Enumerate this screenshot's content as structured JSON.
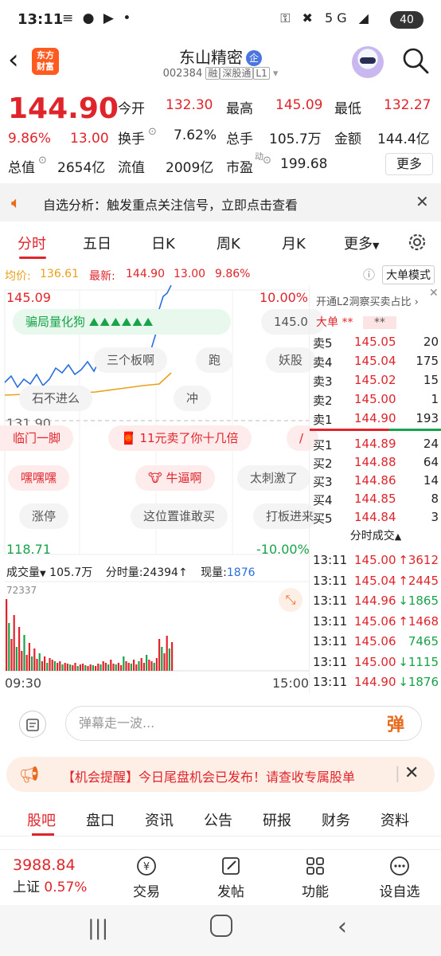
{
  "status": {
    "time": "13:11",
    "left_icons": "≡ ● ▶ •",
    "right_icons": "⚿ ✖ 5G ◢",
    "battery": "40"
  },
  "header": {
    "logo_line1": "东方",
    "logo_line2": "财富",
    "stock_name": "东山精密",
    "badge": "企",
    "code": "002384",
    "tags": [
      "融",
      "深股通",
      "L1"
    ]
  },
  "quote": {
    "price": "144.90",
    "change_pct": "9.86%",
    "change_amt": "13.00",
    "rows": [
      [
        {
          "label": "今开",
          "value": "132.30",
          "color": "red"
        },
        {
          "label": "最高",
          "value": "145.09",
          "color": "red"
        },
        {
          "label": "最低",
          "value": "132.27",
          "color": "red"
        }
      ],
      [
        {
          "label": "换手",
          "value": "7.62%",
          "color": "plain"
        },
        {
          "label": "总手",
          "value": "105.7万",
          "color": "plain"
        },
        {
          "label": "金额",
          "value": "144.4亿",
          "color": "plain"
        }
      ],
      [
        {
          "label": "总值",
          "value": "2654亿",
          "color": "plain"
        },
        {
          "label": "流值",
          "value": "2009亿",
          "color": "plain"
        },
        {
          "label": "市盈",
          "value": "199.68",
          "color": "plain"
        }
      ]
    ],
    "pe_superscript": "动",
    "more_label": "更多"
  },
  "notice": {
    "text": "自选分析：触发重点关注信号，立即点击查看"
  },
  "tabs": [
    "分时",
    "五日",
    "日K",
    "周K",
    "月K",
    "更多"
  ],
  "avg_line": {
    "avg_label": "均价:",
    "avg_value": "136.61",
    "latest_label": "最新:",
    "latest_value": "144.90",
    "latest_amt": "13.00",
    "latest_pct": "9.86%",
    "big_order_mode": "大单模式"
  },
  "chart": {
    "top_price": "145.09",
    "top_pct": "10.00%",
    "mid_price": "131.90",
    "bottom_price": "118.71",
    "bottom_pct": "-10.00%",
    "right_clip_price": "145.0",
    "volume_label": "成交量",
    "volume_value": "105.7万",
    "tick_volume_label": "分时量:",
    "tick_volume_value": "24394",
    "current_volume_label": "现量:",
    "current_volume_value": "1876",
    "volume_max": "72337",
    "start_time": "09:30",
    "end_time": "15:00",
    "danmu": [
      {
        "text": "骗局量化狗"
      },
      {
        "text": "三个板啊"
      },
      {
        "text": "跑"
      },
      {
        "text": "妖股"
      },
      {
        "text": "石不进么"
      },
      {
        "text": "冲"
      },
      {
        "text": "临门一脚"
      },
      {
        "text": "11元卖了你十几倍"
      },
      {
        "text": "嘿嘿嘿"
      },
      {
        "text": "牛逼啊"
      },
      {
        "text": "太刺激了"
      },
      {
        "text": "涨停"
      },
      {
        "text": "这位置谁敢买"
      },
      {
        "text": "打板进来"
      }
    ]
  },
  "orderbook": {
    "header": "开通L2洞察买卖占比",
    "big_order": "大单",
    "stars1": "**",
    "stars2": "**",
    "asks": [
      {
        "label": "卖5",
        "price": "145.05",
        "vol": "20"
      },
      {
        "label": "卖4",
        "price": "145.04",
        "vol": "175"
      },
      {
        "label": "卖3",
        "price": "145.02",
        "vol": "15"
      },
      {
        "label": "卖2",
        "price": "145.00",
        "vol": "1"
      },
      {
        "label": "卖1",
        "price": "144.90",
        "vol": "193"
      }
    ],
    "bids": [
      {
        "label": "买1",
        "price": "144.89",
        "vol": "24"
      },
      {
        "label": "买2",
        "price": "144.88",
        "vol": "64"
      },
      {
        "label": "买3",
        "price": "144.86",
        "vol": "14"
      },
      {
        "label": "买4",
        "price": "144.85",
        "vol": "8"
      },
      {
        "label": "买5",
        "price": "144.84",
        "vol": "3"
      }
    ],
    "trades_header": "分时成交",
    "trades": [
      {
        "time": "13:11",
        "price": "145.00",
        "dir": "up",
        "vol": "3612"
      },
      {
        "time": "13:11",
        "price": "145.04",
        "dir": "up",
        "vol": "2445"
      },
      {
        "time": "13:11",
        "price": "144.96",
        "dir": "down",
        "vol": "1865"
      },
      {
        "time": "13:11",
        "price": "145.06",
        "dir": "up",
        "vol": "1468"
      },
      {
        "time": "13:11",
        "price": "145.06",
        "dir": "none",
        "vol": "7465"
      },
      {
        "time": "13:11",
        "price": "145.00",
        "dir": "down",
        "vol": "1115"
      },
      {
        "time": "13:11",
        "price": "144.90",
        "dir": "down",
        "vol": "1876"
      }
    ]
  },
  "input": {
    "placeholder": "弹幕走一波...",
    "send": "弹"
  },
  "promo": {
    "text": "【机会提醒】今日尾盘机会已发布！请查收专属股单"
  },
  "subtabs": [
    "股吧",
    "盘口",
    "资讯",
    "公告",
    "研报",
    "财务",
    "资料"
  ],
  "bottombar": {
    "index_value": "3988.84",
    "index_name": "上证",
    "index_pct": "0.57%",
    "items": [
      "交易",
      "发帖",
      "功能",
      "设自选"
    ]
  },
  "colors": {
    "up": "#e0242b",
    "down": "#17a34a",
    "accent": "#ff5a1f"
  }
}
